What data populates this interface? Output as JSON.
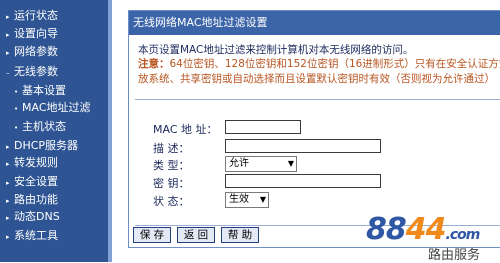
{
  "sidebar": {
    "items": [
      {
        "label": "运行状态",
        "sub": false
      },
      {
        "label": "设置向导",
        "sub": false
      },
      {
        "label": "网络参数",
        "sub": false
      },
      {
        "label": "无线参数",
        "sub": false
      },
      {
        "label": "基本设置",
        "sub": true
      },
      {
        "label": "MAC地址过滤",
        "sub": true
      },
      {
        "label": "主机状态",
        "sub": true
      },
      {
        "label": "DHCP服务器",
        "sub": false
      },
      {
        "label": "转发规则",
        "sub": false
      },
      {
        "label": "安全设置",
        "sub": false
      },
      {
        "label": "路由功能",
        "sub": false
      },
      {
        "label": "动态DNS",
        "sub": false
      },
      {
        "label": "系统工具",
        "sub": false
      }
    ]
  },
  "panel": {
    "title": "无线网络MAC地址过滤设置",
    "intro": "本页设置MAC地址过滤来控制计算机对本无线网络的访问。",
    "note_label": "注意：",
    "note_line1": "64位密钥、128位密钥和152位密钥（16进制形式）只有在安全认证方式",
    "note_line2": "放系统、共享密钥或自动选择而且设置默认密钥时有效（否则视为允许通过）"
  },
  "form": {
    "mac_label": "MAC 地 址：",
    "mac_value": "",
    "desc_label": "描   述：",
    "desc_value": "",
    "type_label": "类   型：",
    "type_value": "允许",
    "key_label": "密   钥：",
    "key_value": "",
    "status_label": "状   态：",
    "status_value": "生效"
  },
  "buttons": {
    "save": "保 存",
    "back": "返 回",
    "help": "帮 助"
  },
  "watermark": {
    "digits_a": "88",
    "digits_b": "44",
    "suffix": ".com",
    "text": "路由服务"
  },
  "colors": {
    "sidebar_bg": "#2e5493",
    "title_bar": "#3c64a8",
    "note_text": "#b85420"
  }
}
